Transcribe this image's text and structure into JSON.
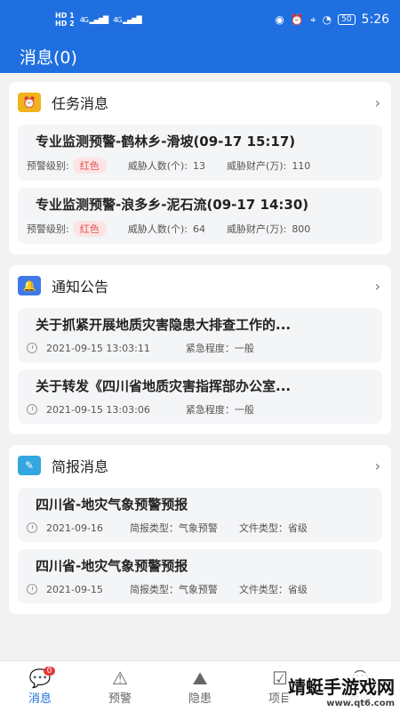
{
  "status_bar": {
    "left_top": "HD 1",
    "left_bottom": "HD 2",
    "sig1": "4G",
    "sig2": "4G",
    "battery": "50",
    "time": "5:26"
  },
  "app_bar": {
    "title": "消息(0)"
  },
  "sections": {
    "task": {
      "title": "任务消息",
      "icon_color": "#f2b21b",
      "items": [
        {
          "title": "专业监测预警-鹤林乡-滑坡(09-17 15:17)",
          "level_label": "预警级别:",
          "level_value": "红色",
          "people_label": "威胁人数(个):",
          "people_value": "13",
          "property_label": "威胁财产(万):",
          "property_value": "110"
        },
        {
          "title": "专业监测预警-浪多乡-泥石流(09-17 14:30)",
          "level_label": "预警级别:",
          "level_value": "红色",
          "people_label": "威胁人数(个):",
          "people_value": "64",
          "property_label": "威胁财产(万):",
          "property_value": "800"
        }
      ]
    },
    "notice": {
      "title": "通知公告",
      "icon_color": "#3f7be8",
      "items": [
        {
          "title": "关于抓紧开展地质灾害隐患大排查工作的...",
          "time": "2021-09-15 13:03:11",
          "urgency": "紧急程度：一般"
        },
        {
          "title": "关于转发《四川省地质灾害指挥部办公室...",
          "time": "2021-09-15 13:03:06",
          "urgency": "紧急程度：一般"
        }
      ]
    },
    "brief": {
      "title": "简报消息",
      "icon_color": "#34a7e0",
      "items": [
        {
          "title": "四川省-地灾气象预警预报",
          "date": "2021-09-16",
          "type": "简报类型：气象预警",
          "file_type": "文件类型：省级"
        },
        {
          "title": "四川省-地灾气象预警预报",
          "date": "2021-09-15",
          "type": "简报类型：气象预警",
          "file_type": "文件类型：省级"
        }
      ]
    }
  },
  "tabs": [
    {
      "label": "消息",
      "icon": "chat-icon",
      "badge": "0"
    },
    {
      "label": "预警",
      "icon": "warning-icon"
    },
    {
      "label": "隐患",
      "icon": "landslide-icon"
    },
    {
      "label": "项目",
      "icon": "project-icon"
    },
    {
      "label": "我的",
      "icon": "user-icon"
    }
  ],
  "watermark": {
    "line1": "靖蜓手游戏网",
    "line2": "www.qt6.com"
  },
  "colors": {
    "primary": "#1f6fe0",
    "red_pill_bg": "#fde3e3",
    "red_pill_text": "#e05555"
  }
}
